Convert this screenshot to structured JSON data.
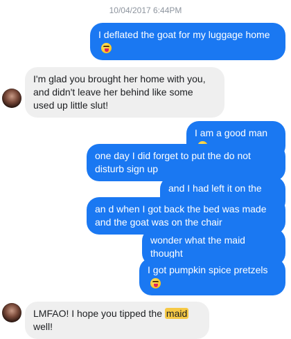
{
  "conversation": {
    "timestamp": "10/04/2017 6:44PM",
    "messages": [
      {
        "from": "me",
        "text": "I deflated the goat for my luggage home",
        "emoji": true
      },
      {
        "from": "them",
        "text": "I'm glad you brought her home with you, and didn't leave her behind like some used up little slut!"
      },
      {
        "from": "me",
        "text": "I am a good man",
        "emoji": true
      },
      {
        "from": "me",
        "text": "one day I did forget to put the do not disturb sign up"
      },
      {
        "from": "me",
        "text": "and I had left it on the bed"
      },
      {
        "from": "me",
        "text": "an d when I got back the bed was made and the goat was on the chair"
      },
      {
        "from": "me",
        "text": "wonder what the maid thought"
      },
      {
        "from": "me",
        "text": "I got pumpkin spice pretzels",
        "emoji": true
      },
      {
        "from": "them",
        "text_before": "LMFAO! I hope you tipped the",
        "highlight": "maid",
        "text_after": "well!"
      }
    ]
  },
  "colors": {
    "outgoing_bubble": "#1a78f2",
    "incoming_bubble": "#efefef",
    "highlight": "#f6c945"
  },
  "icons": {
    "emoji": "grinning-tongue-emoji",
    "avatar": "contact-avatar"
  }
}
